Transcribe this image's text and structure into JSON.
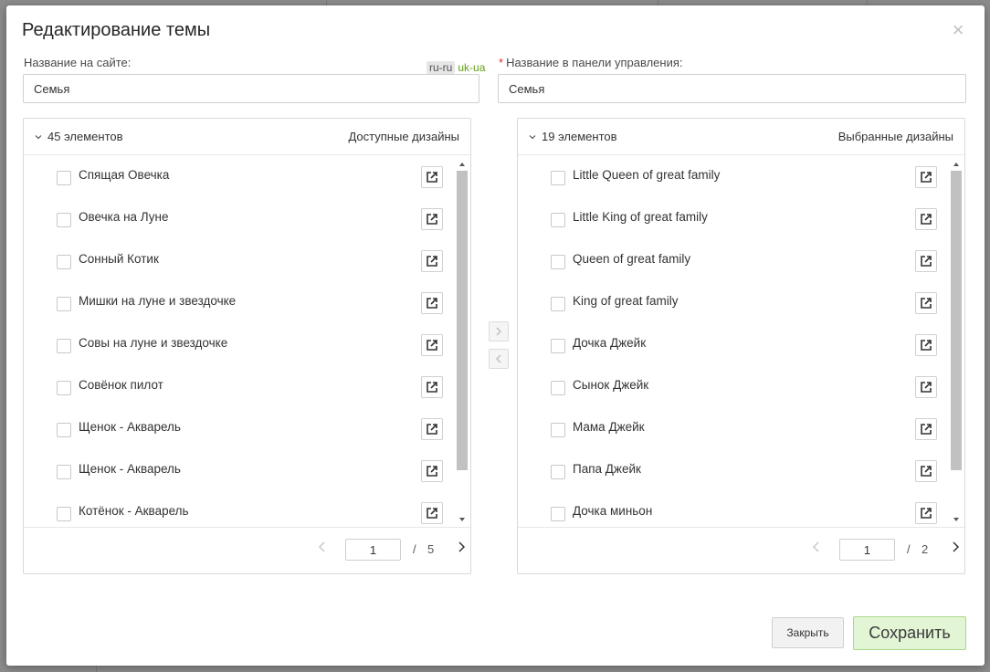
{
  "modal": {
    "title": "Редактирование темы",
    "close_glyph": "×"
  },
  "form": {
    "site_name_label": "Название на сайте:",
    "site_name_value": "Семья",
    "lang_ru": "ru-ru",
    "lang_uk": "uk-ua",
    "admin_name_required_mark": "*",
    "admin_name_label": "Название в панели управления:",
    "admin_name_value": "Семья"
  },
  "left_panel": {
    "count_label": "45 элементов",
    "title": "Доступные дизайны",
    "items": [
      {
        "label": "Спящая Овечка"
      },
      {
        "label": "Овечка на Луне"
      },
      {
        "label": "Сонный Котик"
      },
      {
        "label": "Мишки на луне и звездочке"
      },
      {
        "label": "Совы на луне и звездочке"
      },
      {
        "label": "Совёнок пилот"
      },
      {
        "label": "Щенок - Акварель"
      },
      {
        "label": "Щенок - Акварель"
      },
      {
        "label": "Котёнок - Акварель"
      }
    ],
    "page_current": "1",
    "page_slash": "/",
    "page_total": "5"
  },
  "right_panel": {
    "count_label": "19 элементов",
    "title": "Выбранные дизайны",
    "items": [
      {
        "label": "Little Queen of great family"
      },
      {
        "label": "Little King of great family"
      },
      {
        "label": "Queen of great family"
      },
      {
        "label": "King of great family"
      },
      {
        "label": "Дочка Джейк"
      },
      {
        "label": "Сынок Джейк"
      },
      {
        "label": "Мама Джейк"
      },
      {
        "label": "Папа Джейк"
      },
      {
        "label": "Дочка миньон"
      }
    ],
    "page_current": "1",
    "page_slash": "/",
    "page_total": "2"
  },
  "footer": {
    "close_label": "Закрыть",
    "save_label": "Сохранить"
  },
  "icons": {
    "open_item": "external-link-icon",
    "collapse": "chevron-down-icon",
    "transfer_right": "chevron-right-icon",
    "transfer_left": "chevron-left-icon"
  },
  "colors": {
    "accent_green": "#5f9e17",
    "save_bg": "#e2f5d5",
    "required": "#e02b2b"
  }
}
